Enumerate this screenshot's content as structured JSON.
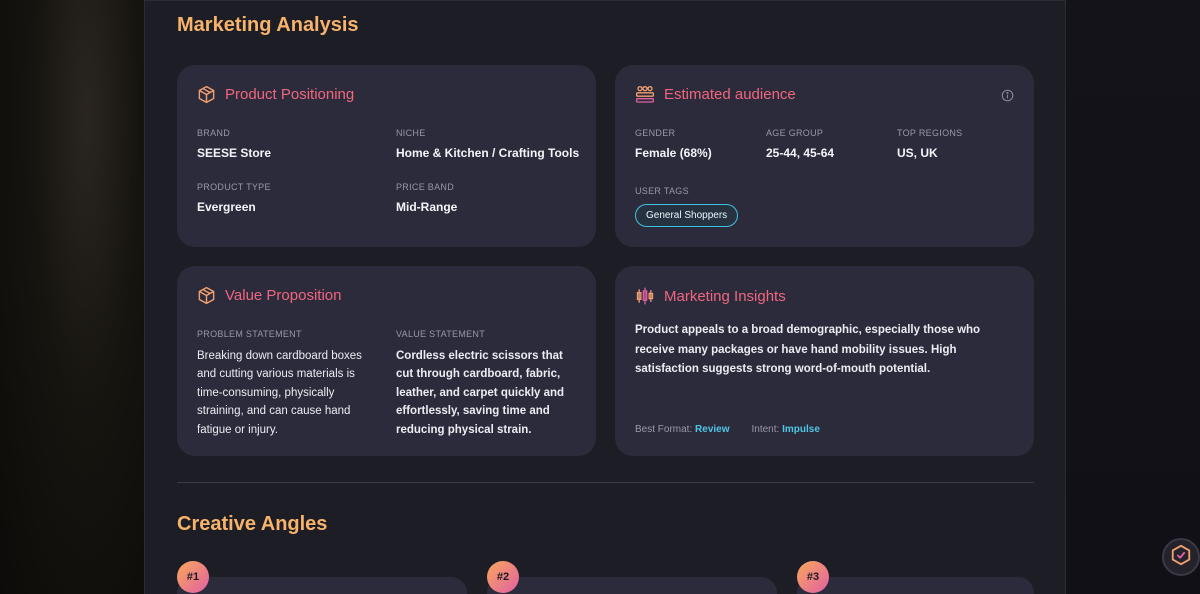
{
  "marketing": {
    "title": "Marketing Analysis",
    "positioning": {
      "title": "Product Positioning",
      "icon": "box-icon",
      "brand_label": "BRAND",
      "brand_value": "SEESE Store",
      "niche_label": "NICHE",
      "niche_value": "Home & Kitchen / Crafting Tools",
      "type_label": "PRODUCT TYPE",
      "type_value": "Evergreen",
      "price_label": "PRICE BAND",
      "price_value": "Mid-Range"
    },
    "audience": {
      "title": "Estimated audience",
      "icon": "group-icon",
      "gender_label": "GENDER",
      "gender_value": "Female (68%)",
      "age_label": "AGE GROUP",
      "age_value": "25-44, 45-64",
      "regions_label": "TOP REGIONS",
      "regions_value": "US, UK",
      "tags_label": "USER TAGS",
      "tags": [
        "General Shoppers"
      ]
    },
    "value_prop": {
      "title": "Value Proposition",
      "icon": "box-icon",
      "problem_label": "PROBLEM STATEMENT",
      "problem_text": "Breaking down cardboard boxes and cutting various materials is time-consuming, physically straining, and can cause hand fatigue or injury.",
      "value_label": "VALUE STATEMENT",
      "value_text": "Cordless electric scissors that cut through cardboard, fabric, leather, and carpet quickly and effortlessly, saving time and reducing physical strain."
    },
    "insights": {
      "title": "Marketing Insights",
      "icon": "candlestick-icon",
      "text": "Product appeals to a broad demographic, especially those who receive many packages or have hand mobility issues. High satisfaction suggests strong word-of-mouth potential.",
      "format_label": "Best Format:",
      "format_value": "Review",
      "intent_label": "Intent:",
      "intent_value": "Impulse"
    }
  },
  "creative": {
    "title": "Creative Angles",
    "badges": [
      "#1",
      "#2",
      "#3"
    ]
  },
  "colors": {
    "section_title": "#f7b36b",
    "card_title": "#f0667f",
    "accent": "#4fc6e6",
    "card_bg": "#2c2b3b"
  }
}
